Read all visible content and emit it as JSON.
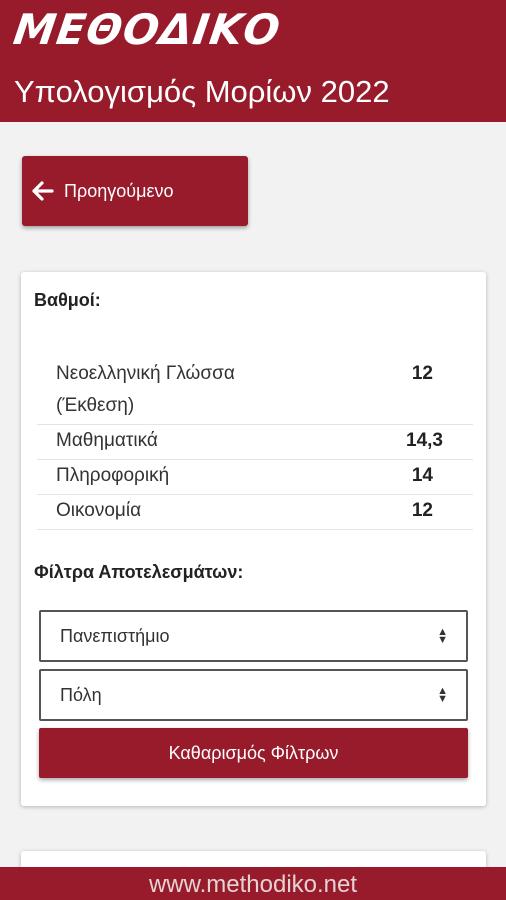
{
  "header": {
    "logo_text": "ΜΕΘΟΔΙΚΟ",
    "subtitle": "Υπολογισμός Μορίων 2022"
  },
  "back_button": {
    "label": "Προηγούμενο",
    "icon": "arrow-left-icon"
  },
  "grades_card": {
    "title": "Βαθμοί:",
    "rows": [
      {
        "subject": "Νεοελληνική Γλώσσα (Έκθεση)",
        "grade": "12"
      },
      {
        "subject": "Μαθηματικά",
        "grade": "14,3"
      },
      {
        "subject": "Πληροφορική",
        "grade": "14"
      },
      {
        "subject": "Οικονομία",
        "grade": "12"
      }
    ],
    "filters_title": "Φίλτρα Αποτελεσμάτων:",
    "university_select": "Πανεπιστήμιο",
    "city_select": "Πόλη",
    "clear_filters_label": "Καθαρισμός Φίλτρων"
  },
  "footer": {
    "text": "www.methodiko.net"
  },
  "colors": {
    "brand": "#971b2a",
    "background": "#f2f2f2"
  }
}
